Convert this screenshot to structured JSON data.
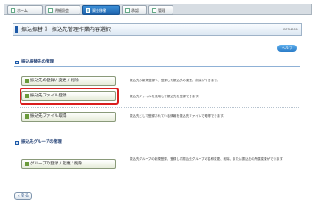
{
  "tabs": [
    {
      "label": "ホーム",
      "icon": "home-icon",
      "active": false
    },
    {
      "label": "明細照会",
      "icon": "document-icon",
      "active": false
    },
    {
      "label": "資金移動",
      "icon": "transfer-icon",
      "active": true
    },
    {
      "label": "承認",
      "icon": "approve-icon",
      "active": false
    },
    {
      "label": "管理",
      "icon": "settings-icon",
      "active": false
    }
  ],
  "page": {
    "title": "振込振替 》 振込先管理作業内容選択",
    "screen_code": "BFR4001",
    "help_label": "ヘルプ"
  },
  "sections": {
    "payee": "振込振替先の管理",
    "group": "振込先グループの管理"
  },
  "menu": [
    {
      "label": "振込先の登録 / 変更 / 削除",
      "desc": "振込先の新規登録や、登録した振込先の変更、削除ができます。"
    },
    {
      "label": "振込先ファイル登録",
      "desc": "振込先ファイルを使用して振込先を登録できます。"
    },
    {
      "label": "振込先ファイル取得",
      "desc": "振込先として登録されている情報を振込先ファイルで取得できます。"
    },
    {
      "label": "グループの登録 / 変更 / 削除",
      "desc": "振込先グループの新規登録、登録した振込先グループの名称変更、削除、または振込先の所属変更ができます。"
    }
  ],
  "back_label": "戻る",
  "colors": {
    "accent": "#1d62ab",
    "highlight": "#d91e1e"
  }
}
